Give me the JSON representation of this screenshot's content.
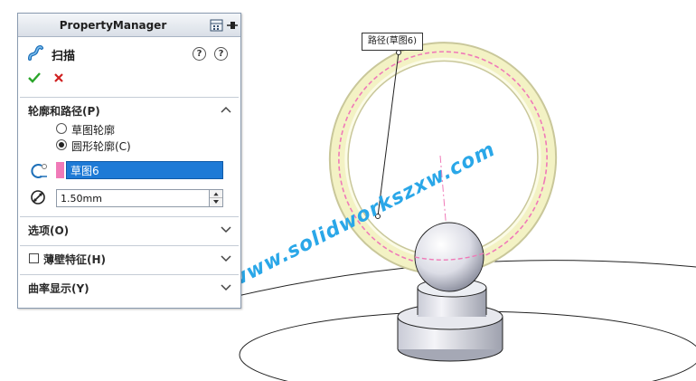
{
  "panel": {
    "title": "PropertyManager",
    "command_name": "扫描",
    "sections": {
      "profile_path": {
        "title": "轮廓和路径(P)",
        "options": [
          "草图轮廓",
          "圆形轮廓(C)"
        ],
        "selected_option": 1,
        "path_selection": "草图6",
        "diameter_value": "1.50mm"
      },
      "options_title": "选项(O)",
      "thin_feature_title": "薄壁特征(H)",
      "curvature_title": "曲率显示(Y)"
    }
  },
  "viewport": {
    "callout_label": "路径(草图6)",
    "watermark": "www.solidworkszxw.com"
  },
  "colors": {
    "selection_blue": "#1e7ad6",
    "path_pink": "#f07ab8",
    "ring_yellow": "#f3f2c4",
    "watermark_blue": "#2aa7e8"
  }
}
